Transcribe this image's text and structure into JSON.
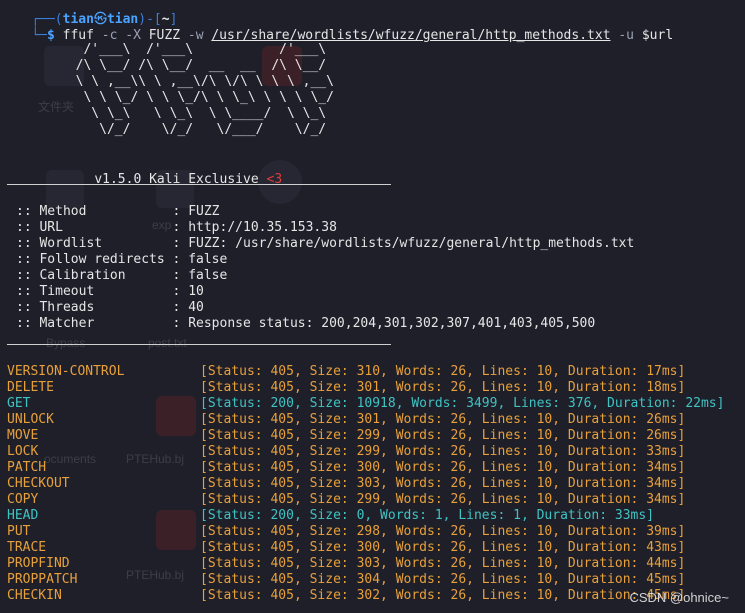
{
  "prompt": {
    "top_prefix": "┌──(",
    "user": "tian",
    "skull": "㉿",
    "host": "tian",
    "top_mid": ")-[",
    "dir": "~",
    "top_suffix": "]",
    "bottom_prefix": "└─",
    "dollar": "$"
  },
  "command": {
    "program": "ffuf",
    "flag_c": "-c",
    "flag_X": "-X",
    "arg_X": "FUZZ",
    "flag_w": "-w",
    "wordlist_path": "/usr/share/wordlists/wfuzz/general/http_methods.txt",
    "flag_u": "-u",
    "arg_u": "$url"
  },
  "banner": {
    "ascii_art": "   /'___\\  /'___\\           /'___\\\n  /\\ \\__/ /\\ \\__/  __  __  /\\ \\__/\n  \\ \\ ,__\\\\ \\ ,__\\/\\ \\/\\ \\ \\ \\ ,__\\\n   \\ \\ \\_/ \\ \\ \\_/\\ \\ \\_\\ \\ \\ \\ \\_/\n    \\ \\_\\   \\ \\_\\  \\ \\____/  \\ \\_\\\n     \\/_/    \\/_/   \\/___/    \\/_/",
    "version": "v1.5.0 Kali Exclusive",
    "heart": "<3"
  },
  "config": [
    {
      "key": "Method",
      "value": "FUZZ"
    },
    {
      "key": "URL",
      "value": "http://10.35.153.38"
    },
    {
      "key": "Wordlist",
      "value": "FUZZ: /usr/share/wordlists/wfuzz/general/http_methods.txt"
    },
    {
      "key": "Follow redirects",
      "value": "false"
    },
    {
      "key": "Calibration",
      "value": "false"
    },
    {
      "key": "Timeout",
      "value": "10"
    },
    {
      "key": "Threads",
      "value": "40"
    },
    {
      "key": "Matcher",
      "value": "Response status: 200,204,301,302,307,401,403,405,500"
    }
  ],
  "results": [
    {
      "method": "VERSION-CONTROL",
      "status": "405",
      "size": "310",
      "words": "26",
      "lines": "10",
      "duration": "17ms"
    },
    {
      "method": "DELETE",
      "status": "405",
      "size": "301",
      "words": "26",
      "lines": "10",
      "duration": "18ms"
    },
    {
      "method": "GET",
      "status": "200",
      "size": "10918",
      "words": "3499",
      "lines": "376",
      "duration": "22ms"
    },
    {
      "method": "UNLOCK",
      "status": "405",
      "size": "301",
      "words": "26",
      "lines": "10",
      "duration": "26ms"
    },
    {
      "method": "MOVE",
      "status": "405",
      "size": "299",
      "words": "26",
      "lines": "10",
      "duration": "26ms"
    },
    {
      "method": "LOCK",
      "status": "405",
      "size": "299",
      "words": "26",
      "lines": "10",
      "duration": "33ms"
    },
    {
      "method": "PATCH",
      "status": "405",
      "size": "300",
      "words": "26",
      "lines": "10",
      "duration": "34ms"
    },
    {
      "method": "CHECKOUT",
      "status": "405",
      "size": "303",
      "words": "26",
      "lines": "10",
      "duration": "34ms"
    },
    {
      "method": "COPY",
      "status": "405",
      "size": "299",
      "words": "26",
      "lines": "10",
      "duration": "34ms"
    },
    {
      "method": "HEAD",
      "status": "200",
      "size": "0",
      "words": "1",
      "lines": "1",
      "duration": "33ms"
    },
    {
      "method": "PUT",
      "status": "405",
      "size": "298",
      "words": "26",
      "lines": "10",
      "duration": "39ms"
    },
    {
      "method": "TRACE",
      "status": "405",
      "size": "300",
      "words": "26",
      "lines": "10",
      "duration": "43ms"
    },
    {
      "method": "PROPFIND",
      "status": "405",
      "size": "303",
      "words": "26",
      "lines": "10",
      "duration": "44ms"
    },
    {
      "method": "PROPPATCH",
      "status": "405",
      "size": "304",
      "words": "26",
      "lines": "10",
      "duration": "45ms"
    },
    {
      "method": "CHECKIN",
      "status": "405",
      "size": "302",
      "words": "26",
      "lines": "10",
      "duration": "45ms"
    }
  ],
  "desktop_ghosts": [
    "文件夹",
    "exp",
    "Bypass",
    "post.txt",
    "ocuments",
    "PTEHub.bj",
    "PTEHub.bj"
  ],
  "watermark": "CSDN @ohnice~",
  "colors": {
    "background": "#1e1f29",
    "prompt_blue": "#4aa3ff",
    "status_405": "#e8a03b",
    "status_200": "#3fc3c3",
    "heart_red": "#e03c3c"
  }
}
